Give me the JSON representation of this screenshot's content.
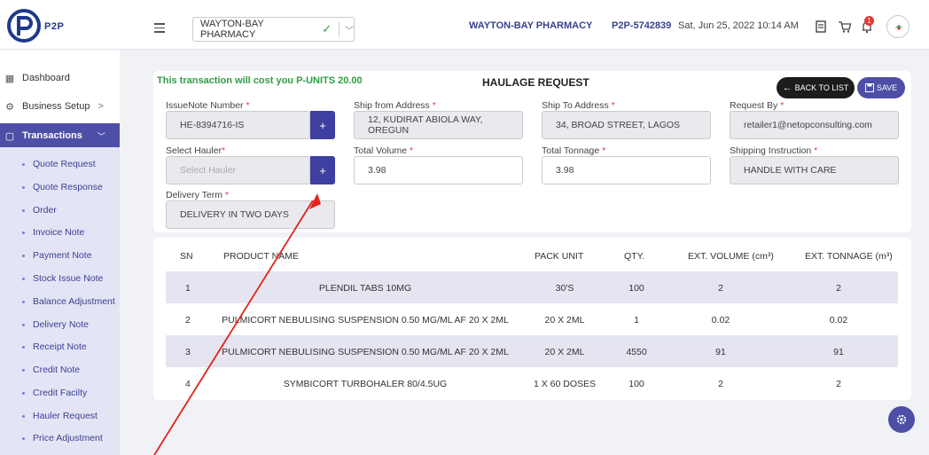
{
  "app": {
    "logo_text": "P2P"
  },
  "header": {
    "pharmacy_selected": "WAYTON-BAY PHARMACY",
    "pharmacy_name": "WAYTON-BAY PHARMACY",
    "account_code": "P2P-5742839",
    "datetime": "Sat, Jun 25, 2022 10:14 AM",
    "notification_count": "1"
  },
  "sidebar": {
    "dashboard": "Dashboard",
    "business_setup": "Business Setup",
    "business_setup_chevron": ">",
    "transactions": "Transactions",
    "sub_items": [
      "Quote Request",
      "Quote Response",
      "Order",
      "Invoice Note",
      "Payment Note",
      "Stock Issue Note",
      "Balance Adjustment",
      "Delivery Note",
      "Receipt Note",
      "Credit Note",
      "Credit Facilty",
      "Hauler Request",
      "Price Adjustment"
    ]
  },
  "form": {
    "cost_notice": "This transaction will cost you P-UNITS 20.00",
    "title": "HAULAGE REQUEST",
    "back_label": "BACK TO LIST",
    "save_label": "SAVE",
    "issue_note_label": "IssueNote Number",
    "issue_note_value": "HE-8394716-IS",
    "ship_from_label": "Ship from Address",
    "ship_from_value": "12, KUDIRAT ABIOLA WAY, OREGUN",
    "ship_to_label": "Ship To Address",
    "ship_to_value": "34, BROAD STREET, LAGOS",
    "request_by_label": "Request By",
    "request_by_value": "retailer1@netopconsulting.com",
    "hauler_label": "Select Hauler",
    "hauler_placeholder": "Select Hauler",
    "total_volume_label": "Total Volume",
    "total_volume_value": "3.98",
    "total_tonnage_label": "Total Tonnage",
    "total_tonnage_value": "3.98",
    "shipping_instruction_label": "Shipping Instruction",
    "shipping_instruction_value": "HANDLE WITH CARE",
    "delivery_term_label": "Delivery Term",
    "delivery_term_value": "DELIVERY IN TWO DAYS",
    "plus": "+",
    "required_mark": "*"
  },
  "table": {
    "headers": {
      "sn": "SN",
      "product": "PRODUCT NAME",
      "pack": "PACK UNIT",
      "qty": "QTY.",
      "volume": "EXT. VOLUME (cm³)",
      "tonnage": "EXT. TONNAGE (m³)"
    },
    "rows": [
      {
        "sn": "1",
        "product": "PLENDIL TABS 10MG",
        "pack": "30'S",
        "qty": "100",
        "volume": "2",
        "tonnage": "2"
      },
      {
        "sn": "2",
        "product": "PULMICORT NEBULISING SUSPENSION 0.50 MG/ML AF 20 X 2ML",
        "pack": "20 X 2ML",
        "qty": "1",
        "volume": "0.02",
        "tonnage": "0.02"
      },
      {
        "sn": "3",
        "product": "PULMICORT NEBULISING SUSPENSION 0.50 MG/ML AF 20 X 2ML",
        "pack": "20 X 2ML",
        "qty": "4550",
        "volume": "91",
        "tonnage": "91"
      },
      {
        "sn": "4",
        "product": "SYMBICORT TURBOHALER 80/4.5UG",
        "pack": "1 X 60 DOSES",
        "qty": "100",
        "volume": "2",
        "tonnage": "2"
      }
    ]
  },
  "colors": {
    "primary": "#4d4fa6",
    "cost_green": "#2e9e44",
    "annotation_red": "#e0241b"
  }
}
